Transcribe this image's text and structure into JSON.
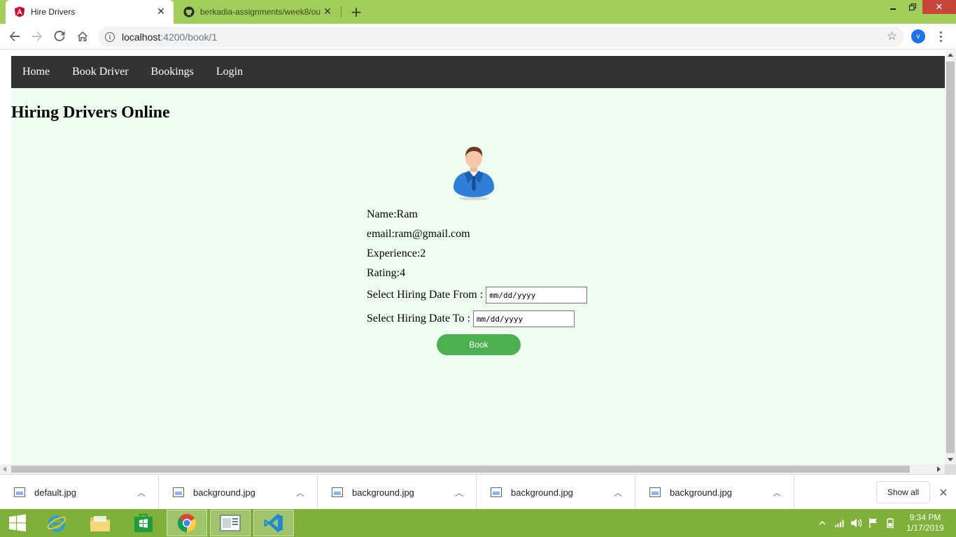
{
  "browser": {
    "tabs": [
      {
        "title": "Hire Drivers",
        "active": true,
        "icon": "angular-icon"
      },
      {
        "title": "berkadia-assignments/week8/ou",
        "active": false,
        "icon": "github-icon"
      }
    ],
    "url_host": "localhost",
    "url_path": ":4200/book/1",
    "profile_initial": "v"
  },
  "nav": {
    "links": [
      "Home",
      "Book Driver",
      "Bookings",
      "Login"
    ]
  },
  "page": {
    "title": "Hiring Drivers Online",
    "driver": {
      "name": "Name:Ram",
      "email": "email:ram@gmail.com",
      "experience": "Experience:2",
      "rating": "Rating:4"
    },
    "date_from_label": "Select Hiring Date From :",
    "date_to_label": "Select Hiring Date To :",
    "date_placeholder": "mm/dd/yyyy",
    "book_label": "Book"
  },
  "downloads": {
    "items": [
      "default.jpg",
      "background.jpg",
      "background.jpg",
      "background.jpg",
      "background.jpg"
    ],
    "show_all": "Show all"
  },
  "taskbar": {
    "time": "9:34 PM",
    "date": "1/17/2019"
  },
  "colors": {
    "titlebar": "#a3cd5b",
    "navbar": "#333333",
    "page_bg": "#efffef",
    "book_button": "#4caf50",
    "taskbar": "#7fb03a"
  }
}
